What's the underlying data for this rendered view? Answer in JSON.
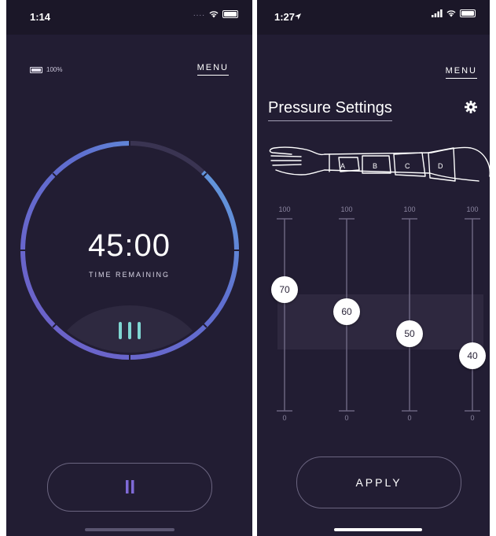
{
  "left_screen": {
    "status_time": "1:14",
    "battery_percent": "100%",
    "menu_label": "MENU",
    "timer_value": "45:00",
    "timer_caption": "TIME REMAINING",
    "pause_icon": "pause-icon",
    "progress_fraction": 0.88
  },
  "right_screen": {
    "status_time": "1:27",
    "menu_label": "MENU",
    "title": "Pressure Settings",
    "settings_icon": "gear-icon",
    "zones": [
      "A",
      "B",
      "C",
      "D"
    ],
    "sliders": [
      {
        "zone": "A",
        "max": "100",
        "min": "0",
        "value": "70"
      },
      {
        "zone": "B",
        "max": "100",
        "min": "0",
        "value": "60"
      },
      {
        "zone": "C",
        "max": "100",
        "min": "0",
        "value": "50"
      },
      {
        "zone": "D",
        "max": "100",
        "min": "0",
        "value": "40"
      }
    ],
    "apply_label": "APPLY"
  },
  "colors": {
    "background": "#221d33",
    "ring_accent": "#6f5fc8",
    "ring_highlight": "#63a9e0",
    "teal": "#7fd6d2",
    "pause_purple": "#7f6ad6"
  }
}
